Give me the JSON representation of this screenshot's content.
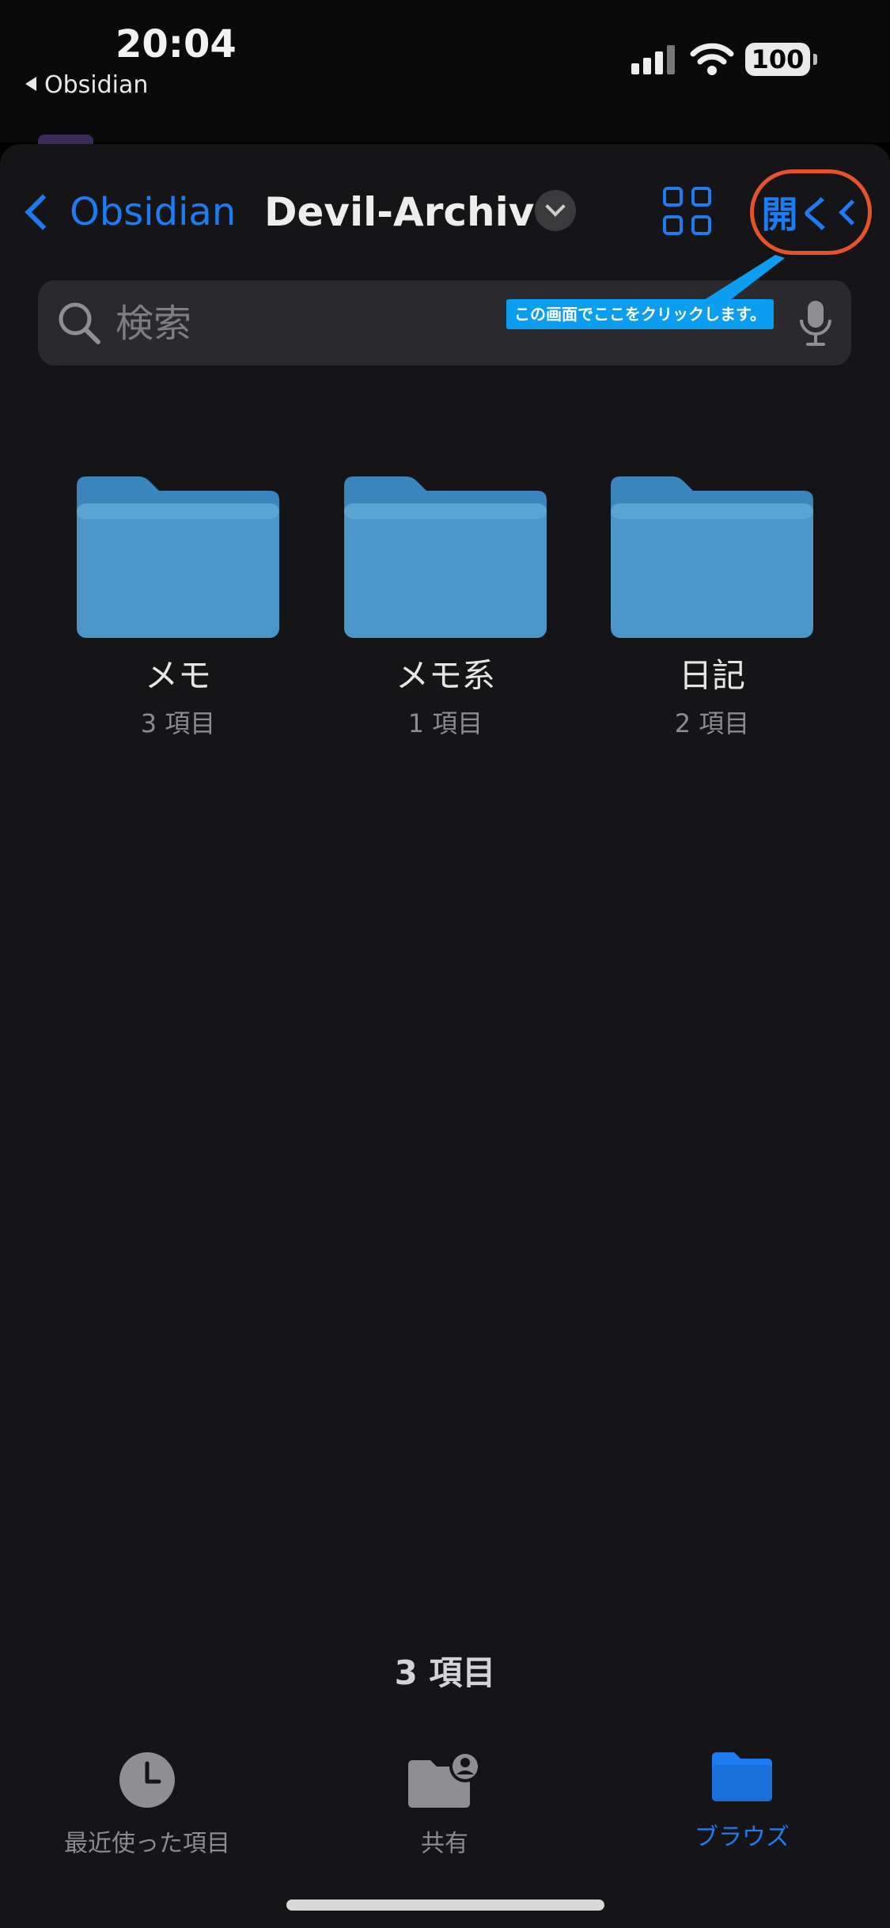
{
  "status": {
    "time": "20:04",
    "back_app": "Obsidian",
    "battery": "100"
  },
  "nav": {
    "back_label": "Obsidian",
    "title": "Devil-Archive",
    "open_label": "開く"
  },
  "search": {
    "placeholder": "検索"
  },
  "annotation": {
    "text": "この画面でここをクリックします。"
  },
  "folders": [
    {
      "name": "メモ",
      "count": "3 項目"
    },
    {
      "name": "メモ系",
      "count": "1 項目"
    },
    {
      "name": "日記",
      "count": "2 項目"
    }
  ],
  "summary": {
    "item_count": "3 項目"
  },
  "tabs": [
    {
      "label": "最近使った項目",
      "icon": "clock-icon"
    },
    {
      "label": "共有",
      "icon": "shared-folder-icon"
    },
    {
      "label": "ブラウズ",
      "icon": "folder-icon"
    }
  ],
  "colors": {
    "accent": "#1d7cf2",
    "annotation_circle": "#e4532a",
    "annotation_label": "#0b9ef0",
    "folder": "#4a96c8"
  }
}
